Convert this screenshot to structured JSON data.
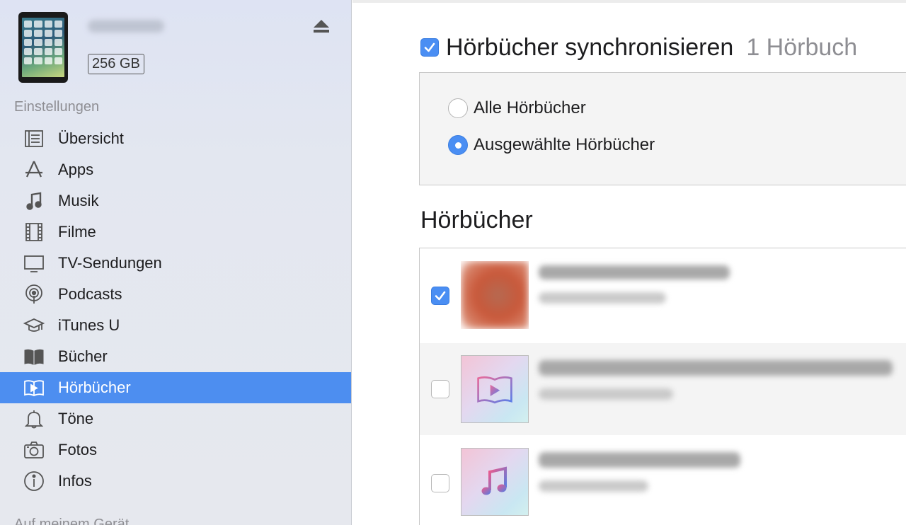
{
  "device": {
    "capacity": "256 GB",
    "eject_icon": "eject-icon"
  },
  "sidebar": {
    "settings_header": "Einstellungen",
    "on_device_header": "Auf meinem Gerät",
    "items": [
      {
        "label": "Übersicht",
        "icon": "summary-list-icon",
        "selected": false
      },
      {
        "label": "Apps",
        "icon": "app-store-icon",
        "selected": false
      },
      {
        "label": "Musik",
        "icon": "music-note-icon",
        "selected": false
      },
      {
        "label": "Filme",
        "icon": "film-strip-icon",
        "selected": false
      },
      {
        "label": "TV-Sendungen",
        "icon": "tv-icon",
        "selected": false
      },
      {
        "label": "Podcasts",
        "icon": "podcast-icon",
        "selected": false
      },
      {
        "label": "iTunes U",
        "icon": "graduation-cap-icon",
        "selected": false
      },
      {
        "label": "Bücher",
        "icon": "book-icon",
        "selected": false
      },
      {
        "label": "Hörbücher",
        "icon": "audiobook-icon",
        "selected": true
      },
      {
        "label": "Töne",
        "icon": "bell-icon",
        "selected": false
      },
      {
        "label": "Fotos",
        "icon": "camera-icon",
        "selected": false
      },
      {
        "label": "Infos",
        "icon": "info-icon",
        "selected": false
      }
    ]
  },
  "main": {
    "sync_checked": true,
    "sync_label": "Hörbücher synchronisieren",
    "sync_count": "1 Hörbuch",
    "options": [
      {
        "label": "Alle Hörbücher",
        "selected": false
      },
      {
        "label": "Ausgewählte Hörbücher",
        "selected": true
      }
    ],
    "list_title": "Hörbücher",
    "audiobooks": [
      {
        "checked": true,
        "artwork": "blurred-cover-art"
      },
      {
        "checked": false,
        "artwork": "audiobook-placeholder-art"
      },
      {
        "checked": false,
        "artwork": "music-placeholder-art"
      }
    ]
  },
  "colors": {
    "accent": "#4d8ef0",
    "sidebar_bg": "#e3e7f0",
    "secondary_text": "#8e8e93"
  }
}
